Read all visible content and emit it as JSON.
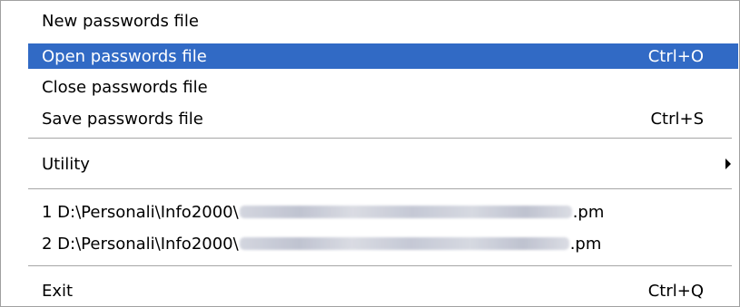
{
  "menu": {
    "items": [
      {
        "label": "New passwords file",
        "shortcut": ""
      },
      {
        "label": "Open passwords file",
        "shortcut": "Ctrl+O"
      },
      {
        "label": "Close passwords file",
        "shortcut": ""
      },
      {
        "label": "Save passwords file",
        "shortcut": "Ctrl+S"
      }
    ],
    "utility": {
      "label": "Utility"
    },
    "recent": [
      {
        "prefix": "1 D:\\Personali\\Info2000\\",
        "suffix": ".pm"
      },
      {
        "prefix": "2 D:\\Personali\\Info2000\\",
        "suffix": ".pm"
      }
    ],
    "exit": {
      "label": "Exit",
      "shortcut": "Ctrl+Q"
    }
  },
  "colors": {
    "highlight": "#316ac5",
    "highlight_text": "#ffffff",
    "separator": "#a6a6a6"
  }
}
